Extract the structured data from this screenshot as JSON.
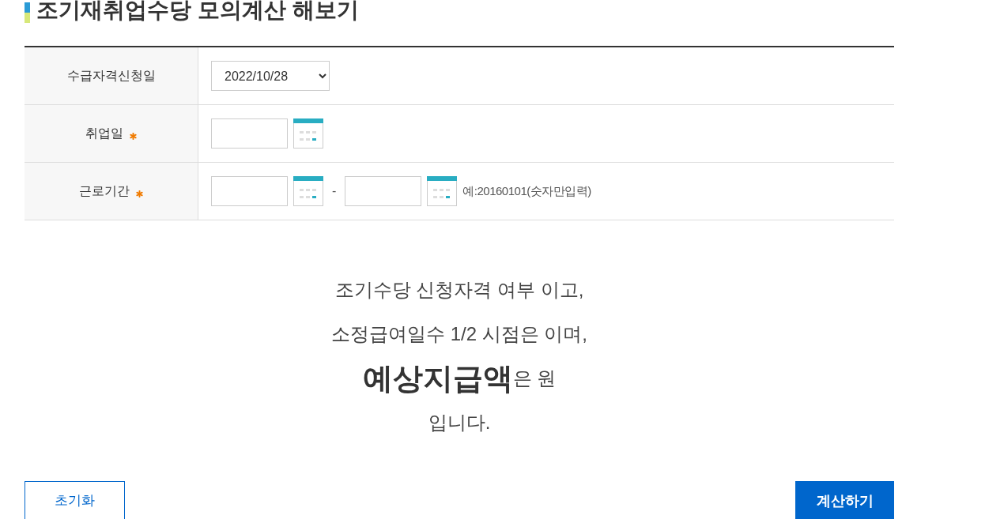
{
  "title": "조기재취업수당 모의계산 해보기",
  "form": [
    {
      "kind": "select",
      "label": "수급자격신청일",
      "required": false,
      "value": "2022/10/28"
    },
    {
      "kind": "date",
      "label": "취업일",
      "required": true
    },
    {
      "kind": "period",
      "label": "근로기간",
      "required": true,
      "separator": "-",
      "hint": "예:20160101(숫자만입력)"
    }
  ],
  "result": [
    "조기수당 신청자격 여부 이고,",
    "소정급여일수 1/2 시점은 이며,",
    "**예상지급액**은 원",
    "입니다."
  ],
  "buttons": [
    {
      "kind": "outline",
      "label": "초기화"
    },
    {
      "kind": "primary",
      "label": "계산하기"
    }
  ]
}
